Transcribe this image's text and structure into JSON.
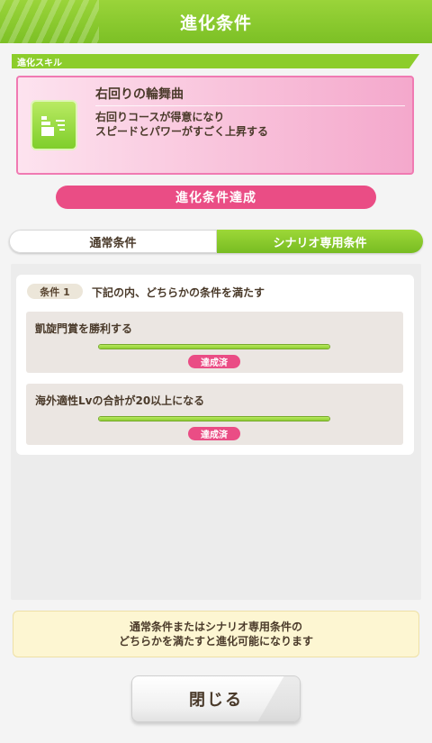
{
  "header": {
    "title": "進化条件"
  },
  "section": {
    "label": "進化スキル"
  },
  "skill": {
    "icon": "speed-up-icon",
    "name": "右回りの輪舞曲",
    "desc_line1": "右回りコースが得意になり",
    "desc_line2": "スピードとパワーがすごく上昇する"
  },
  "status": {
    "label": "進化条件達成"
  },
  "tabs": [
    {
      "label": "通常条件",
      "active": false
    },
    {
      "label": "シナリオ専用条件",
      "active": true
    }
  ],
  "conditions": {
    "badge": "条件 1",
    "heading": "下記の内、どちらかの条件を満たす",
    "items": [
      {
        "text": "凱旋門賞を勝利する",
        "progress": 1.0,
        "status": "達成済"
      },
      {
        "text": "海外適性Lvの合計が20以上になる",
        "progress": 1.0,
        "status": "達成済"
      }
    ]
  },
  "note": {
    "line1": "通常条件またはシナリオ専用条件の",
    "line2": "どちらかを満たすと進化可能になります"
  },
  "close_label": "閉じる",
  "colors": {
    "accent_green": "#8ccd2b",
    "accent_pink": "#ea4d85"
  }
}
